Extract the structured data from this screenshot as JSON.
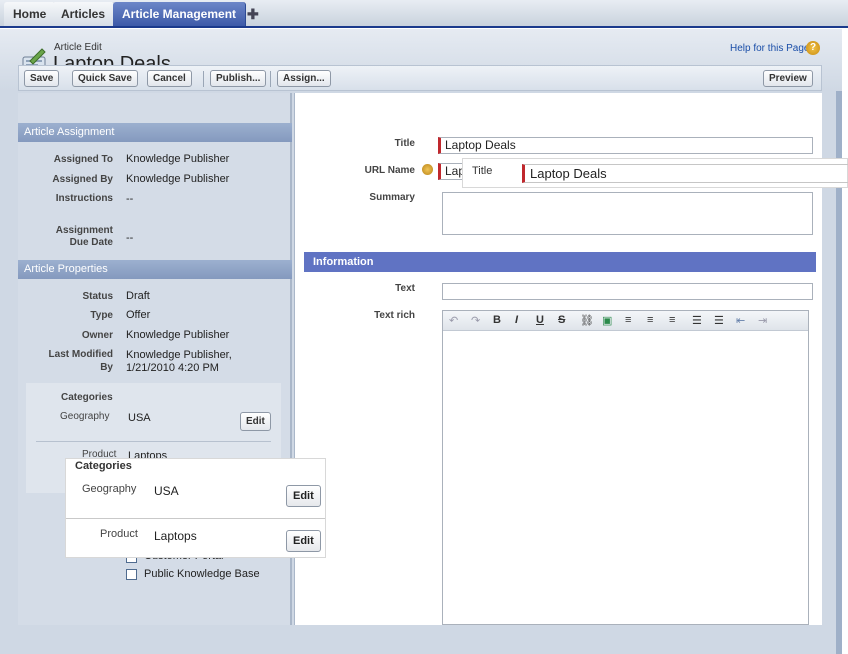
{
  "tabs": [
    "Home",
    "Articles",
    "Article Management",
    "✚"
  ],
  "header": {
    "breadcrumb": "Article Edit",
    "title": "Laptop Deals",
    "help_link": "Help for this Page",
    "help_icon_glyph": "?"
  },
  "toolbar": {
    "save": "Save",
    "quick_save": "Quick Save",
    "cancel": "Cancel",
    "publish": "Publish...",
    "assign": "Assign...",
    "preview": "Preview"
  },
  "assignment": {
    "heading": "Article Assignment",
    "assigned_to_label": "Assigned To",
    "assigned_to": "Knowledge Publisher",
    "assigned_by_label": "Assigned By",
    "assigned_by": "Knowledge Publisher",
    "instructions_label": "Instructions",
    "instructions": "--",
    "due_label_1": "Assignment",
    "due_label_2": "Due Date",
    "due": "--"
  },
  "properties": {
    "heading": "Article Properties",
    "status_label": "Status",
    "status": "Draft",
    "type_label": "Type",
    "type": "Offer",
    "owner_label": "Owner",
    "owner": "Knowledge Publisher",
    "modified_label_1": "Last Modified",
    "modified_label_2": "By",
    "modified_1": "Knowledge Publisher,",
    "modified_2": "1/21/2010 4:20 PM"
  },
  "categories": {
    "heading": "Categories",
    "geography_label": "Geography",
    "geography": "USA",
    "product_label": "Product",
    "product": "Laptops",
    "edit": "Edit"
  },
  "channels": {
    "customer_portal": "Customer Portal",
    "public_kb": "Public Knowledge Base"
  },
  "form": {
    "title_label": "Title",
    "title_value": "Laptop Deals",
    "url_label": "URL Name",
    "url_value": "Lap",
    "summary_label": "Summary",
    "info_heading": "Information",
    "text_label": "Text",
    "text_rich_label": "Text rich"
  },
  "editor_toolbar": [
    "↶",
    "↷",
    "B",
    "I",
    "U",
    "S",
    "⛓",
    "▣",
    "≡",
    "≡",
    "≡",
    "☰",
    "☰",
    "⇤",
    "⇥"
  ],
  "zoom_title": {
    "label": "Title",
    "value": "Laptop Deals"
  },
  "zoom_categories": {
    "heading": "Categories",
    "geography_label": "Geography",
    "geography": "USA",
    "product_label": "Product",
    "product": "Laptops",
    "edit": "Edit"
  }
}
